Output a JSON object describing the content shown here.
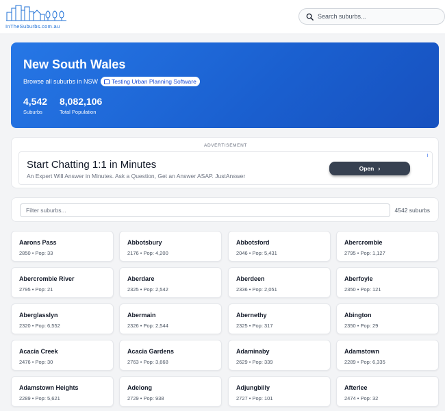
{
  "header": {
    "logo_text": "InTheSuburbs.com.au",
    "search_placeholder": "Search suburbs..."
  },
  "hero": {
    "title": "New South Wales",
    "subtitle": "Browse all suburbs in NSW",
    "badge": "Testing Urban Planning Software",
    "stats": [
      {
        "value": "4,542",
        "label": "Suburbs"
      },
      {
        "value": "8,082,106",
        "label": "Total Population"
      }
    ]
  },
  "ad": {
    "label": "ADVERTISEMENT",
    "title": "Start Chatting 1:1 in Minutes",
    "text": "An Expert Will Answer in Minutes. Ask a Question, Get an Answer ASAP. JustAnswer",
    "button": "Open",
    "info": "i"
  },
  "filter": {
    "placeholder": "Filter suburbs...",
    "count": "4542 suburbs"
  },
  "suburbs": [
    {
      "name": "Aarons Pass",
      "meta": "2850 • Pop: 33"
    },
    {
      "name": "Abbotsbury",
      "meta": "2176 • Pop: 4,200"
    },
    {
      "name": "Abbotsford",
      "meta": "2046 • Pop: 5,431"
    },
    {
      "name": "Abercrombie",
      "meta": "2795 • Pop: 1,127"
    },
    {
      "name": "Abercrombie River",
      "meta": "2795 • Pop: 21"
    },
    {
      "name": "Aberdare",
      "meta": "2325 • Pop: 2,542"
    },
    {
      "name": "Aberdeen",
      "meta": "2336 • Pop: 2,051"
    },
    {
      "name": "Aberfoyle",
      "meta": "2350 • Pop: 121"
    },
    {
      "name": "Aberglasslyn",
      "meta": "2320 • Pop: 6,552"
    },
    {
      "name": "Abermain",
      "meta": "2326 • Pop: 2,544"
    },
    {
      "name": "Abernethy",
      "meta": "2325 • Pop: 317"
    },
    {
      "name": "Abington",
      "meta": "2350 • Pop: 29"
    },
    {
      "name": "Acacia Creek",
      "meta": "2476 • Pop: 30"
    },
    {
      "name": "Acacia Gardens",
      "meta": "2763 • Pop: 3,668"
    },
    {
      "name": "Adaminaby",
      "meta": "2629 • Pop: 339"
    },
    {
      "name": "Adamstown",
      "meta": "2289 • Pop: 6,335"
    },
    {
      "name": "Adamstown Heights",
      "meta": "2289 • Pop: 5,621"
    },
    {
      "name": "Adelong",
      "meta": "2729 • Pop: 938"
    },
    {
      "name": "Adjungbilly",
      "meta": "2727 • Pop: 101"
    },
    {
      "name": "Afterlee",
      "meta": "2474 • Pop: 32"
    }
  ]
}
